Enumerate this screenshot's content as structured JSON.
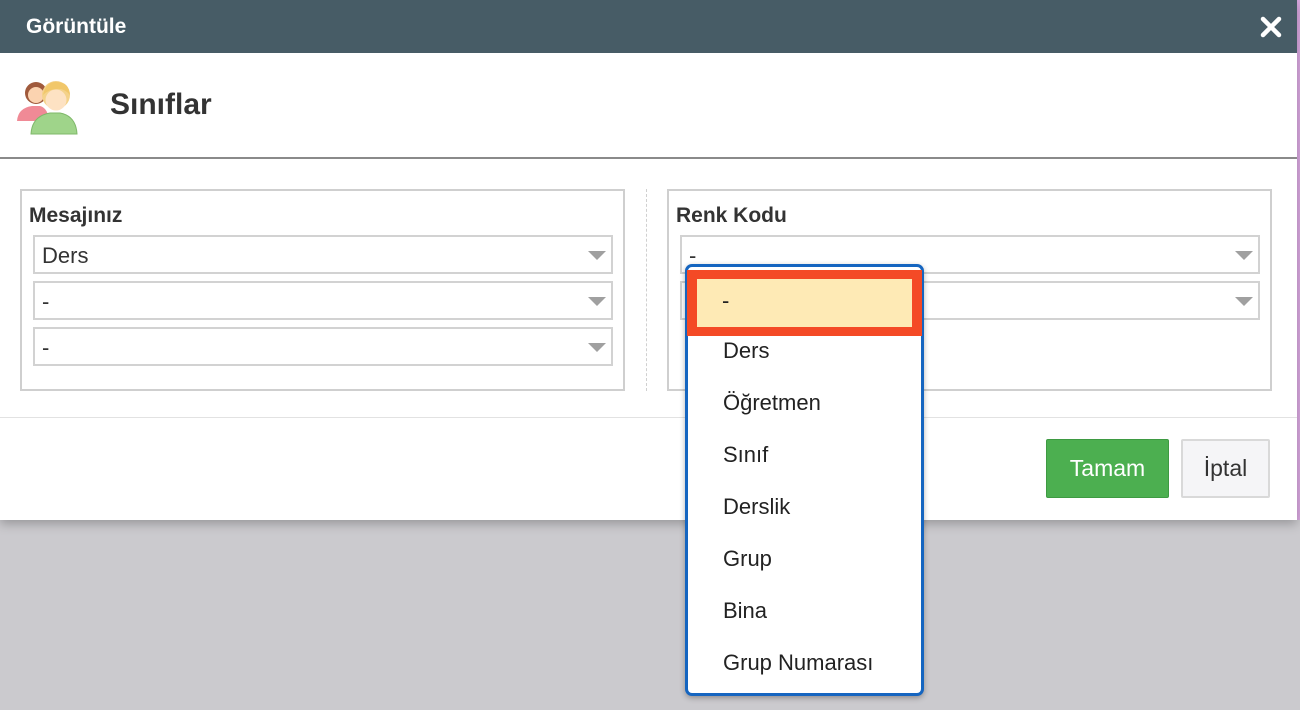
{
  "dialog": {
    "title": "Görüntüle",
    "close_icon": "close-icon"
  },
  "header": {
    "icon": "users-icon",
    "title": "Sınıflar"
  },
  "left_panel": {
    "label": "Mesajınız",
    "selects": [
      "Ders",
      "-",
      "-"
    ]
  },
  "right_panel": {
    "label": "Renk Kodu",
    "selects": [
      "-",
      ""
    ]
  },
  "dropdown": {
    "highlighted_index": 0,
    "options": [
      "-",
      "Ders",
      "Öğretmen",
      "Sınıf",
      "Derslik",
      "Grup",
      "Bina",
      "Grup Numarası"
    ]
  },
  "buttons": {
    "ok_label": "Tamam",
    "cancel_label": "İptal"
  },
  "colors": {
    "title_bar": "#475c66",
    "ok_button": "#4caf50",
    "highlight_border": "#f44a26",
    "highlight_fill": "#feeab5",
    "dropdown_border": "#1565c0"
  }
}
